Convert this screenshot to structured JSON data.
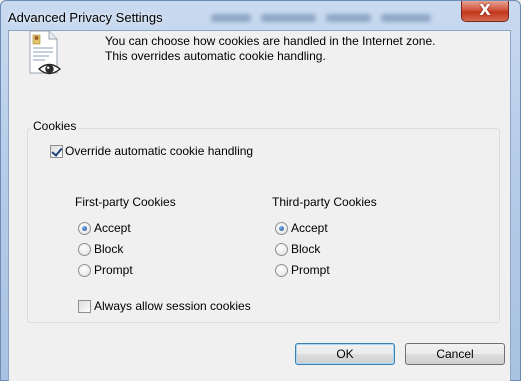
{
  "window": {
    "title": "Advanced Privacy Settings",
    "close_glyph": "X"
  },
  "info": {
    "icon": "privacy-document-eye-icon",
    "line1": "You can choose how cookies are handled in the Internet zone.",
    "line2": "This overrides automatic cookie handling."
  },
  "cookies": {
    "group_label": "Cookies",
    "override_label": "Override automatic cookie handling",
    "override_checked": true,
    "first_party": {
      "heading": "First-party Cookies",
      "options": [
        "Accept",
        "Block",
        "Prompt"
      ],
      "selected": "Accept"
    },
    "third_party": {
      "heading": "Third-party Cookies",
      "options": [
        "Accept",
        "Block",
        "Prompt"
      ],
      "selected": "Accept"
    },
    "session_label": "Always allow session cookies",
    "session_checked": false
  },
  "buttons": {
    "ok": "OK",
    "cancel": "Cancel"
  },
  "colors": {
    "title_gradient_top": "#c9daf0",
    "close_button": "#c2361c",
    "client_background": "#f0f0f0"
  }
}
